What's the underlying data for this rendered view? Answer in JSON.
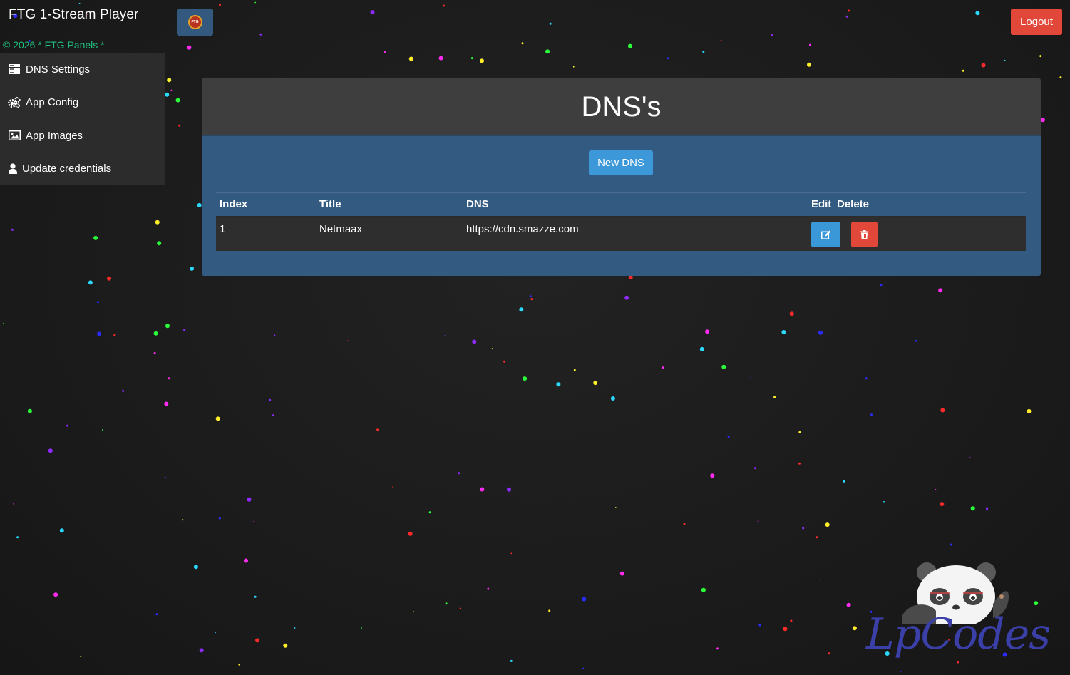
{
  "app": {
    "title": "FTG 1-Stream Player",
    "copyright": "© 2026 * FTG Panels *"
  },
  "header": {
    "logout_label": "Logout",
    "logo_text": "FTG"
  },
  "sidebar": {
    "items": [
      {
        "label": "DNS Settings",
        "icon": "server-icon"
      },
      {
        "label": "App Config",
        "icon": "gears-icon"
      },
      {
        "label": "App Images",
        "icon": "image-icon"
      },
      {
        "label": "Update credentials",
        "icon": "user-icon"
      }
    ]
  },
  "main": {
    "title": "DNS's",
    "new_button": "New DNS",
    "table": {
      "headers": {
        "index": "Index",
        "title": "Title",
        "dns": "DNS",
        "edit": "Edit",
        "delete": "Delete"
      },
      "rows": [
        {
          "index": "1",
          "title": "Netmaax",
          "dns": "https://cdn.smazze.com"
        }
      ]
    }
  },
  "watermark": {
    "text": "LpCodes"
  },
  "colors": {
    "accent_blue": "#3c98d9",
    "danger_red": "#e2483a",
    "panel_blue": "#335a80",
    "copyright_green": "#1fbf7f"
  }
}
